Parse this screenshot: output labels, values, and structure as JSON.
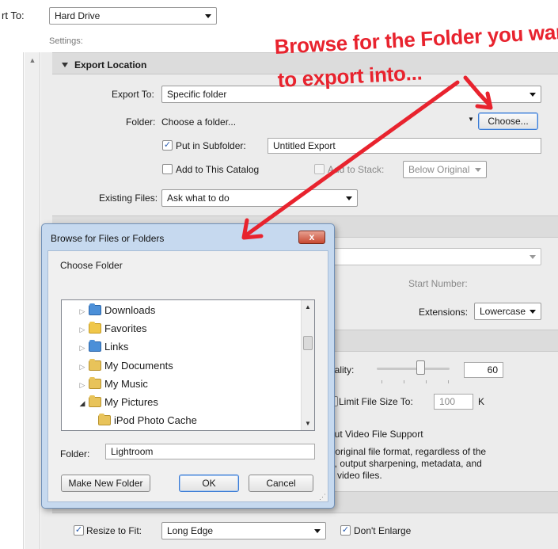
{
  "top": {
    "export_to_label": "rt To:",
    "export_to_value": "Hard Drive",
    "settings_label": "Settings:"
  },
  "export_location": {
    "title": "Export Location",
    "export_to_label": "Export To:",
    "export_to_value": "Specific folder",
    "folder_label": "Folder:",
    "folder_value": "Choose a folder...",
    "choose_button": "Choose...",
    "put_in_subfolder_label": "Put in Subfolder:",
    "put_in_subfolder_checked": true,
    "subfolder_value": "Untitled Export",
    "add_to_catalog_label": "Add to This Catalog",
    "add_to_stack_label": "Add to Stack:",
    "add_to_stack_value": "Below Original",
    "existing_files_label": "Existing Files:",
    "existing_files_value": "Ask what to do"
  },
  "file_naming": {
    "start_number_label": "Start Number:",
    "extensions_label": "Extensions:",
    "extensions_value": "Lowercase"
  },
  "file_settings": {
    "quality_label": "uality:",
    "quality_value": "60",
    "limit_file_size_label": "Limit File Size To:",
    "limit_file_size_value": "100",
    "limit_unit": "K",
    "video_support_label": "out Video File Support",
    "video_desc_1": "r original file format, regardless of the",
    "video_desc_2": "g, output sharpening, metadata, and",
    "video_desc_3": "o video files."
  },
  "image_sizing": {
    "resize_label": "Resize to Fit:",
    "resize_checked": true,
    "resize_value": "Long Edge",
    "dont_enlarge_label": "Don't Enlarge",
    "dont_enlarge_checked": true
  },
  "annotation": {
    "line1": "Browse for the Folder you want",
    "line2": "to export into...",
    "color": "#e8232e"
  },
  "dialog": {
    "title": "Browse for Files or Folders",
    "close_label": "x",
    "choose_folder_label": "Choose Folder",
    "tree": [
      {
        "label": "Downloads",
        "icon": "downloads-folder-icon"
      },
      {
        "label": "Favorites",
        "icon": "favorites-folder-icon"
      },
      {
        "label": "Links",
        "icon": "links-folder-icon"
      },
      {
        "label": "My Documents",
        "icon": "documents-folder-icon"
      },
      {
        "label": "My Music",
        "icon": "music-folder-icon"
      },
      {
        "label": "My Pictures",
        "icon": "pictures-folder-icon"
      },
      {
        "label": "iPod Photo Cache",
        "icon": "folder-icon"
      }
    ],
    "folder_label": "Folder:",
    "folder_value": "Lightroom",
    "make_new_folder_button": "Make New Folder",
    "ok_button": "OK",
    "cancel_button": "Cancel"
  }
}
